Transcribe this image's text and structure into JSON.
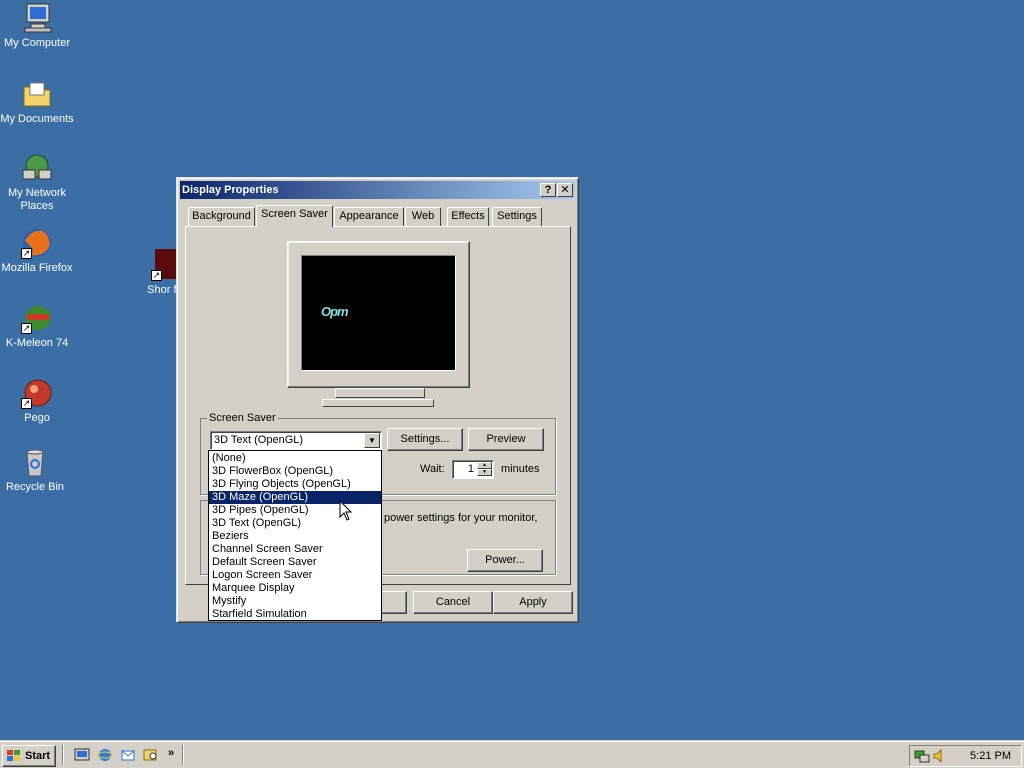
{
  "desktop": {
    "icons": [
      {
        "label": "My Computer"
      },
      {
        "label": "My Documents"
      },
      {
        "label": "My Network Places"
      },
      {
        "label": "Mozilla Firefox"
      },
      {
        "label": "K-Meleon 74"
      },
      {
        "label": "Pego"
      },
      {
        "label": "Recycle Bin"
      },
      {
        "label": "Shor flashp"
      }
    ]
  },
  "dialog": {
    "title": "Display Properties",
    "help_btn": "?",
    "close_btn": "✕",
    "tabs": [
      {
        "label": "Background"
      },
      {
        "label": "Screen Saver"
      },
      {
        "label": "Appearance"
      },
      {
        "label": "Web"
      },
      {
        "label": "Effects"
      },
      {
        "label": "Settings"
      }
    ],
    "preview_text": "Opm",
    "screensaver_group": "Screen Saver",
    "selected_screensaver": "3D Text (OpenGL)",
    "settings_btn": "Settings...",
    "preview_btn": "Preview",
    "wait_label": "Wait:",
    "wait_value": "1",
    "minutes_label": "minutes",
    "power_text": "power settings for your monitor,",
    "power_btn": "Power...",
    "cancel_btn": "Cancel",
    "apply_btn": "Apply",
    "dropdown_items": [
      {
        "label": "(None)"
      },
      {
        "label": "3D FlowerBox (OpenGL)"
      },
      {
        "label": "3D Flying Objects (OpenGL)"
      },
      {
        "label": "3D Maze (OpenGL)"
      },
      {
        "label": "3D Pipes (OpenGL)"
      },
      {
        "label": "3D Text (OpenGL)"
      },
      {
        "label": "Beziers"
      },
      {
        "label": "Channel Screen Saver"
      },
      {
        "label": "Default Screen Saver"
      },
      {
        "label": "Logon Screen Saver"
      },
      {
        "label": "Marquee Display"
      },
      {
        "label": "Mystify"
      },
      {
        "label": "Starfield Simulation"
      }
    ],
    "highlighted_item": "3D Maze (OpenGL)"
  },
  "taskbar": {
    "start_label": "Start",
    "chevron": "»",
    "clock": "5:21 PM"
  },
  "colors": {
    "desktop": "#3a6ea5",
    "title_active": "#0a246a",
    "face": "#d4d0c8"
  }
}
